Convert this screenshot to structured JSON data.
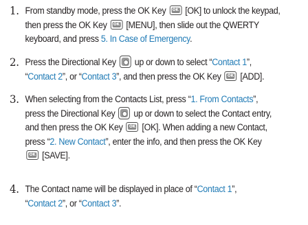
{
  "steps": [
    {
      "number": "1.",
      "lines": [
        [
          "From standby mode, press the OK Key ",
          {
            "icon": "ok-key-icon"
          },
          " [OK] to unlock the keypad,"
        ],
        [
          "then press the OK Key ",
          {
            "icon": "ok-key-icon"
          },
          " [MENU], then slide out the QWERTY"
        ],
        [
          "keyboard, and press ",
          {
            "link": "5. In Case of Emergency"
          },
          "."
        ]
      ]
    },
    {
      "number": "2.",
      "lines": [
        [
          "Press the Directional Key ",
          {
            "icon": "directional-key-icon"
          },
          " up or down to select “",
          {
            "link": "Contact 1"
          },
          "”,"
        ],
        [
          "“",
          {
            "link": "Contact 2"
          },
          "”, or “",
          {
            "link": "Contact 3"
          },
          "”, and then press the OK Key ",
          {
            "icon": "ok-key-icon"
          },
          " [ADD]."
        ]
      ]
    },
    {
      "number": "3.",
      "lines": [
        [
          "When selecting from the Contacts List, press “",
          {
            "link": "1. From Contacts"
          },
          "”,"
        ],
        [
          "press the Directional Key ",
          {
            "icon": "directional-key-icon"
          },
          " up or down to select the Contact entry,"
        ],
        [
          "and then press the OK Key ",
          {
            "icon": "ok-key-icon"
          },
          " [OK]. When adding a new Contact,"
        ],
        [
          "press “",
          {
            "link": "2. New Contact"
          },
          "”, enter the info, and then press the OK Key"
        ],
        [
          {
            "icon": "ok-key-icon"
          },
          " [SAVE]."
        ]
      ]
    },
    {
      "number": "4.",
      "lines": [
        [
          "The Contact name will be displayed in place of “",
          {
            "link": "Contact 1"
          },
          "”,"
        ],
        [
          "“",
          {
            "link": "Contact 2"
          },
          "”, or “",
          {
            "link": "Contact 3"
          },
          "”."
        ]
      ]
    }
  ],
  "key_label": "OK",
  "colors": {
    "text": "#231f20",
    "highlight": "#1f7ab5"
  }
}
